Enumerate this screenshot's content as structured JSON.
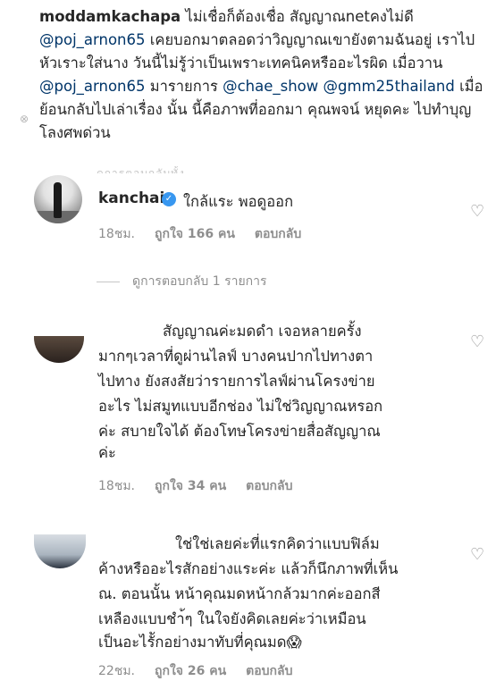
{
  "caption": {
    "username": "moddamkachapa",
    "segments": [
      {
        "t": "text",
        "v": " ไม่เชื่อก็ต้องเชื่อ สัญญาณnetคงไม่ดี "
      },
      {
        "t": "mention",
        "v": "@poj_arnon65"
      },
      {
        "t": "text",
        "v": " เคยบอกมาตลอดว่าวิญญาณเขายังตามฉันอยู่ เราไปหัวเราะใส่นาง วันนี้ไม่รู้ว่าเป็นเพราะเทคนิคหรืออะไรผิด เมื่อวาน "
      },
      {
        "t": "mention",
        "v": "@poj_arnon65"
      },
      {
        "t": "text",
        "v": " มารายการ "
      },
      {
        "t": "mention",
        "v": "@chae_show"
      },
      {
        "t": "text",
        "v": " "
      },
      {
        "t": "mention",
        "v": "@gmm25thailand"
      },
      {
        "t": "text",
        "v": " เมื่อย้อนกลับไปเล่าเรื่อง นั้น นี้คือภาพที่ออกมา คุณพจน์ หยุดคะ ไปทำบุญโลงศพด่วน"
      }
    ],
    "x_mark": "⊗",
    "faded": "ดูการตอบกลับทั้ง"
  },
  "reply": {
    "username": "kanchai",
    "verified_mark": "✓",
    "text": "ใกล้แระ พอดูออก",
    "time": "18ชม.",
    "likes": "ถูกใจ 166 คน",
    "reply_label": "ตอบกลับ"
  },
  "view_replies": "ดูการตอบกลับ 1 รายการ",
  "comments": [
    {
      "lines": [
        "สัญญาณค่ะมดดำ เจอหลายครั้ง",
        "มากๆเวลาที่ดูผ่านไลฟ์ บางคนปากไปทางตา",
        "ไปทาง ยังสงสัยว่ารายการไลฟ์ผ่านโครงข่าย",
        "อะไร ไม่สมูทแบบอีกช่อง ไม่ใช่วิญญาณหรอก",
        "ค่ะ สบายใจได้ ต้องโทษโครงข่ายสื่อสัญญาณ",
        "ค่ะ"
      ],
      "time": "18ชม.",
      "likes": "ถูกใจ 34 คน",
      "reply_label": "ตอบกลับ"
    },
    {
      "lines": [
        "ใช่ใช่เลยค่ะที่แรกคิดว่าแบบฟิล์ม",
        "ค้างหรืออะไรสักอย่างแระค่ะ แล้วก็นึกภาพที่เห็น",
        "ณ. ตอนนั้น หน้าคุณมดหน้ากล้วมากค่ะออกสี",
        "เหลืองแบบชำ้ๆ ในใจยังคิดเลยค่ะว่าเหมือน",
        "เป็นอะไรัักอย่างมาทับที่คุณมด😱"
      ],
      "time": "22ชม.",
      "likes": "ถูกใจ 26 คน",
      "reply_label": "ตอบกลับ"
    }
  ],
  "icons": {
    "heart": "♡"
  }
}
